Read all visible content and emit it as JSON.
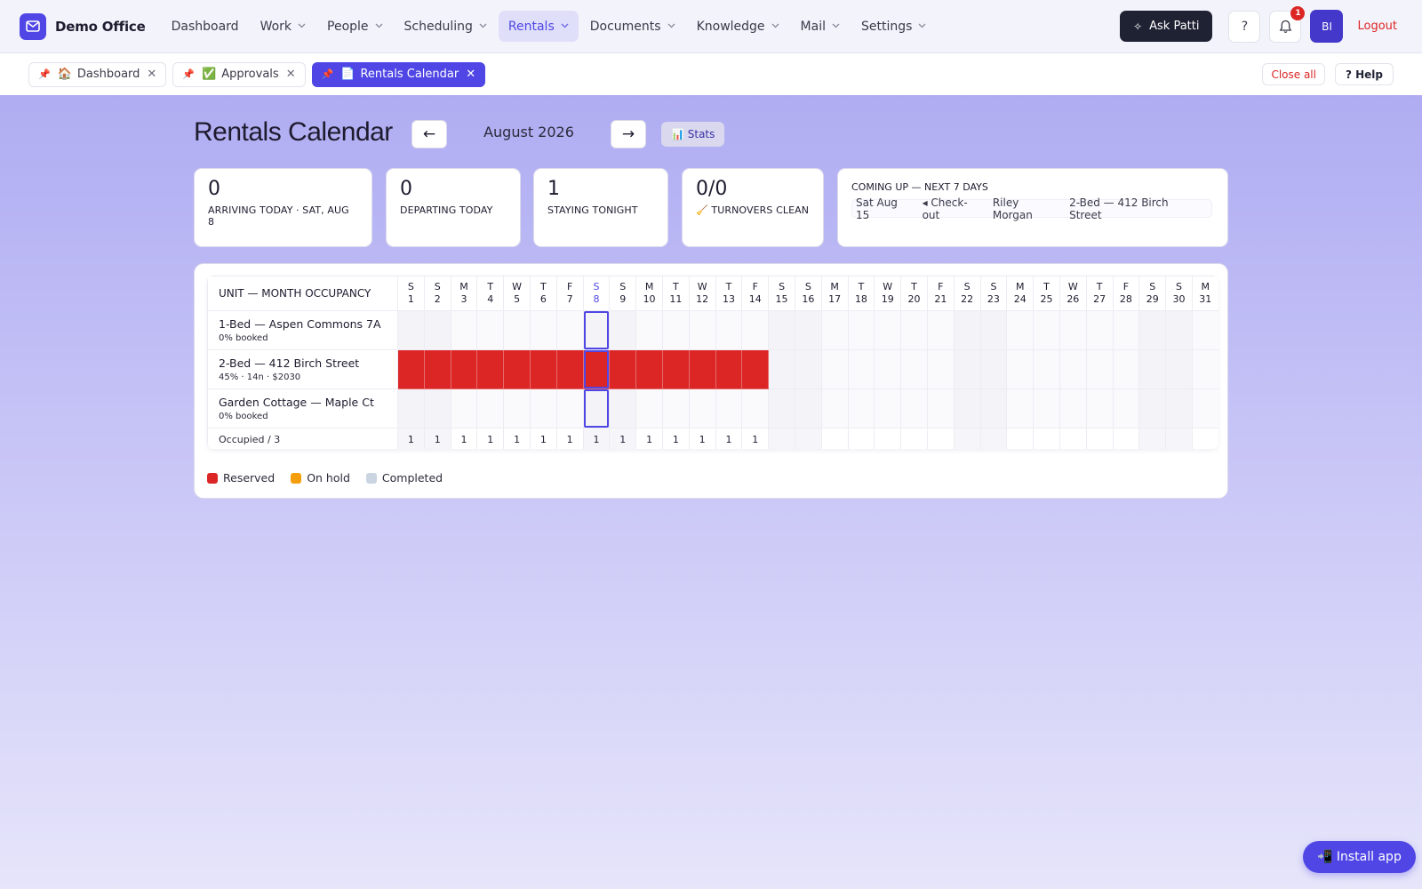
{
  "brand": {
    "name": "Demo Office"
  },
  "nav": {
    "items": [
      {
        "label": "Dashboard",
        "dropdown": false,
        "active": false
      },
      {
        "label": "Work",
        "dropdown": true,
        "active": false
      },
      {
        "label": "People",
        "dropdown": true,
        "active": false
      },
      {
        "label": "Scheduling",
        "dropdown": true,
        "active": false
      },
      {
        "label": "Rentals",
        "dropdown": true,
        "active": true
      },
      {
        "label": "Documents",
        "dropdown": true,
        "active": false
      },
      {
        "label": "Knowledge",
        "dropdown": true,
        "active": false
      },
      {
        "label": "Mail",
        "dropdown": true,
        "active": false
      },
      {
        "label": "Settings",
        "dropdown": true,
        "active": false
      }
    ],
    "ask_label": "Ask Patti",
    "help_glyph": "?",
    "notification_count": "1",
    "avatar_initials": "BI",
    "logout_label": "Logout"
  },
  "tabs": {
    "items": [
      {
        "emoji": "🏠",
        "label": "Dashboard",
        "active": false
      },
      {
        "emoji": "✅",
        "label": "Approvals",
        "active": false
      },
      {
        "emoji": "📄",
        "label": "Rentals Calendar",
        "active": true
      }
    ],
    "close_all_label": "Close all",
    "help_label": "? Help"
  },
  "page": {
    "title": "Rentals Calendar",
    "prev_glyph": "←",
    "next_glyph": "→",
    "month_label": "August 2026",
    "stats_label": "📊 Stats"
  },
  "kpis": {
    "arriving": {
      "value": "0",
      "label": "ARRIVING TODAY · SAT, AUG 8"
    },
    "departing": {
      "value": "0",
      "label": "DEPARTING TODAY"
    },
    "staying": {
      "value": "1",
      "label": "STAYING TONIGHT"
    },
    "turnovers": {
      "value": "0/0",
      "label": "🧹 TURNOVERS CLEAN"
    }
  },
  "upcoming": {
    "title": "COMING UP — NEXT 7 DAYS",
    "rows": [
      {
        "date": "Sat Aug 15",
        "event": "◂ Check-out",
        "guest": "Riley Morgan",
        "unit": "2-Bed — 412 Birch Street"
      }
    ]
  },
  "calendar": {
    "unit_header": "UNIT — MONTH OCCUPANCY",
    "today_day": 8,
    "days": [
      {
        "d": "S",
        "n": "1"
      },
      {
        "d": "S",
        "n": "2"
      },
      {
        "d": "M",
        "n": "3"
      },
      {
        "d": "T",
        "n": "4"
      },
      {
        "d": "W",
        "n": "5"
      },
      {
        "d": "T",
        "n": "6"
      },
      {
        "d": "F",
        "n": "7"
      },
      {
        "d": "S",
        "n": "8"
      },
      {
        "d": "S",
        "n": "9"
      },
      {
        "d": "M",
        "n": "10"
      },
      {
        "d": "T",
        "n": "11"
      },
      {
        "d": "W",
        "n": "12"
      },
      {
        "d": "T",
        "n": "13"
      },
      {
        "d": "F",
        "n": "14"
      },
      {
        "d": "S",
        "n": "15"
      },
      {
        "d": "S",
        "n": "16"
      },
      {
        "d": "M",
        "n": "17"
      },
      {
        "d": "T",
        "n": "18"
      },
      {
        "d": "W",
        "n": "19"
      },
      {
        "d": "T",
        "n": "20"
      },
      {
        "d": "F",
        "n": "21"
      },
      {
        "d": "S",
        "n": "22"
      },
      {
        "d": "S",
        "n": "23"
      },
      {
        "d": "M",
        "n": "24"
      },
      {
        "d": "T",
        "n": "25"
      },
      {
        "d": "W",
        "n": "26"
      },
      {
        "d": "T",
        "n": "27"
      },
      {
        "d": "F",
        "n": "28"
      },
      {
        "d": "S",
        "n": "29"
      },
      {
        "d": "S",
        "n": "30"
      },
      {
        "d": "M",
        "n": "31"
      }
    ],
    "units": [
      {
        "name": "1-Bed — Aspen Commons 7A",
        "summary": "0% booked",
        "reserved_days": []
      },
      {
        "name": "2-Bed — 412 Birch Street",
        "summary": "45% · 14n · $2030",
        "reserved_days": [
          1,
          2,
          3,
          4,
          5,
          6,
          7,
          8,
          9,
          10,
          11,
          12,
          13,
          14
        ]
      },
      {
        "name": "Garden Cottage — Maple Ct",
        "summary": "0% booked",
        "reserved_days": []
      }
    ],
    "footer_label": "Occupied / 3",
    "occupied_counts": [
      "1",
      "1",
      "1",
      "1",
      "1",
      "1",
      "1",
      "1",
      "1",
      "1",
      "1",
      "1",
      "1",
      "1",
      "",
      "",
      "",
      "",
      "",
      "",
      "",
      "",
      "",
      "",
      "",
      "",
      "",
      "",
      "",
      "",
      ""
    ]
  },
  "legend": [
    {
      "label": "Reserved",
      "color": "#dc2626"
    },
    {
      "label": "On hold",
      "color": "#f59e0b"
    },
    {
      "label": "Completed",
      "color": "#cbd5e1"
    }
  ],
  "install_label": "📲 Install app",
  "colors": {
    "accent": "#4f46e5",
    "reserved": "#dc2626",
    "danger": "#dc2626"
  }
}
